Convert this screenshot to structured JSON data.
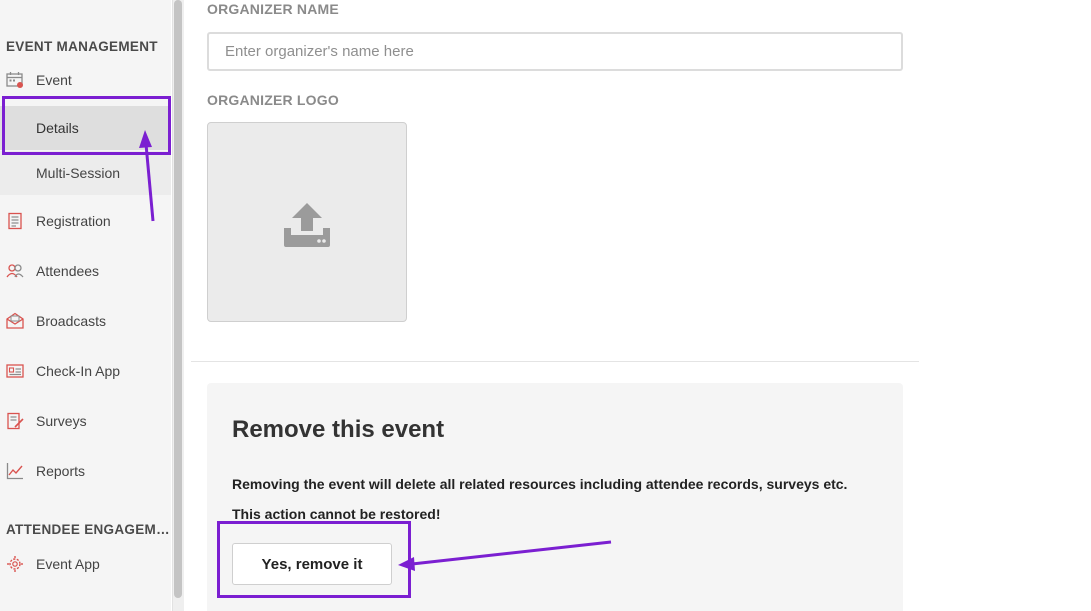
{
  "sidebar": {
    "section_event_management": "EVENT MANAGEMENT",
    "section_attendee_engagement": "ATTENDEE ENGAGEMENT",
    "items": {
      "event": "Event",
      "details": "Details",
      "multi_session": "Multi-Session",
      "registration": "Registration",
      "attendees": "Attendees",
      "broadcasts": "Broadcasts",
      "checkin_app": "Check-In App",
      "surveys": "Surveys",
      "reports": "Reports",
      "event_app": "Event App"
    }
  },
  "main": {
    "organizer_name_label": "ORGANIZER NAME",
    "organizer_name_placeholder": "Enter organizer's name here",
    "organizer_name_value": "",
    "organizer_logo_label": "ORGANIZER LOGO",
    "remove_section": {
      "title": "Remove this event",
      "description": "Removing the event will delete all related resources including attendee records, surveys etc.",
      "warning": "This action cannot be restored!",
      "button_label": "Yes, remove it"
    }
  },
  "colors": {
    "annotation": "#7b1fd1",
    "icon_red": "#d9534f",
    "icon_gray": "#8a8a8a",
    "sidebar_bg": "#f5f5f5"
  },
  "icons": {
    "event": "calendar-icon",
    "registration": "clipboard-icon",
    "attendees": "users-icon",
    "broadcasts": "envelope-icon",
    "checkin_app": "id-card-icon",
    "surveys": "survey-edit-icon",
    "reports": "line-chart-icon",
    "event_app": "gear-people-icon",
    "upload": "upload-icon"
  }
}
